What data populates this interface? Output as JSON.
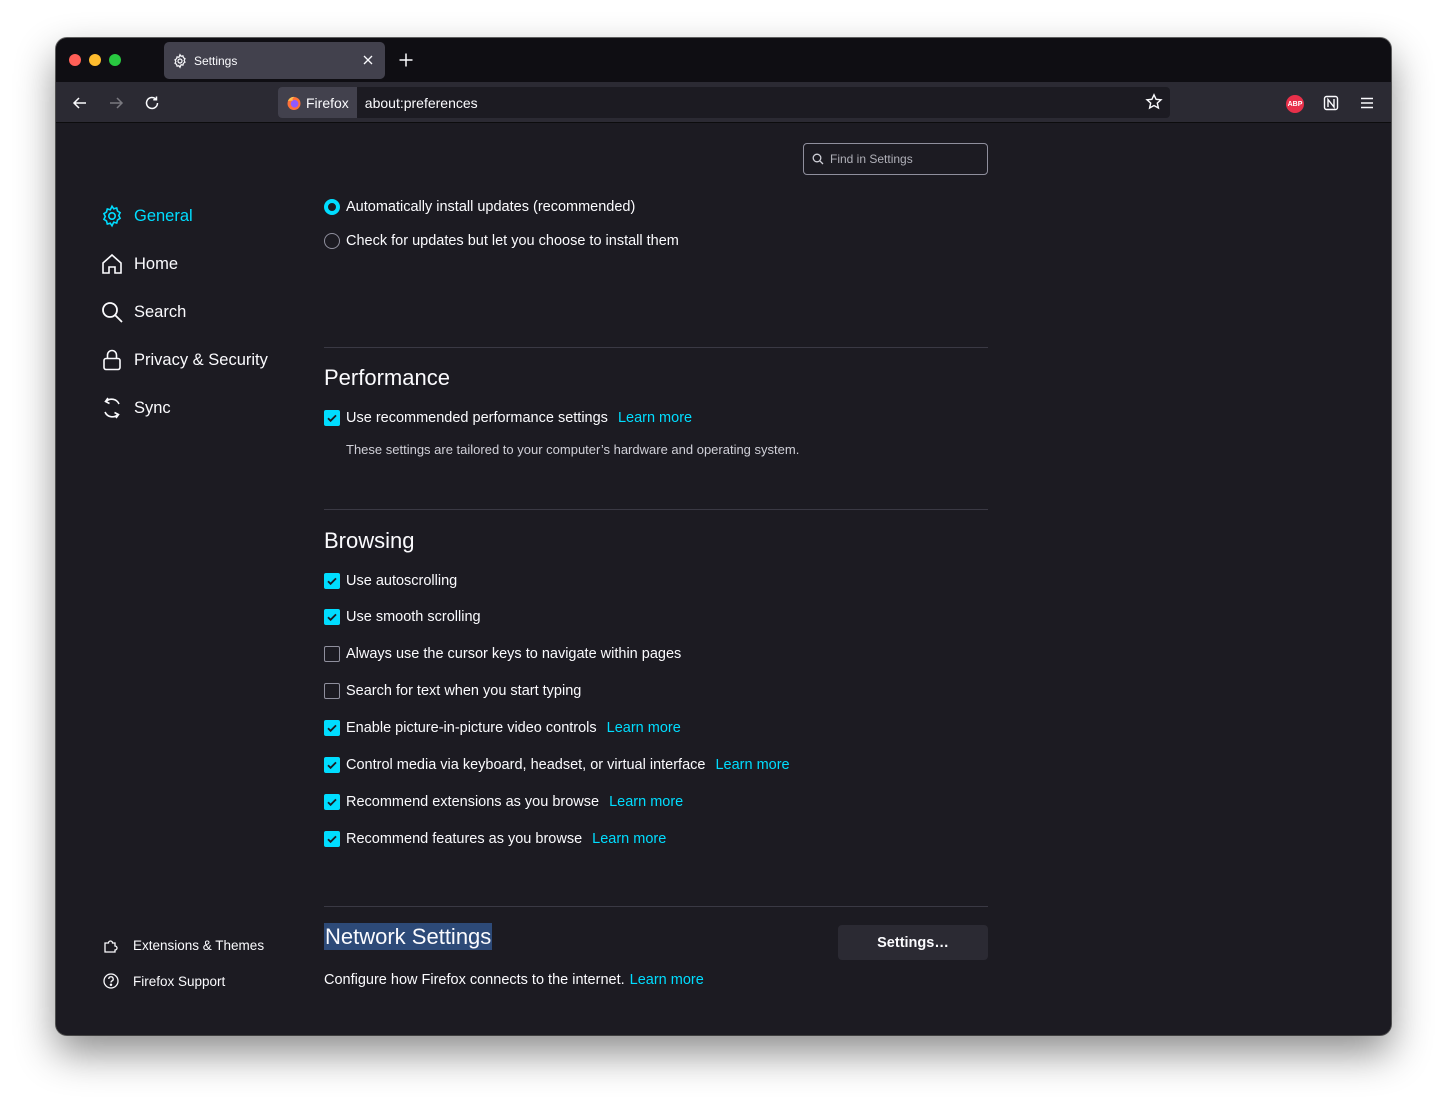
{
  "tab": {
    "title": "Settings",
    "icon": "gear-icon"
  },
  "urlbar": {
    "identity_label": "Firefox",
    "url": "about:preferences"
  },
  "extensions": {
    "abp_label": "ABP"
  },
  "search": {
    "placeholder": "Find in Settings"
  },
  "sidebar": {
    "items": [
      {
        "label": "General",
        "icon": "gear-icon",
        "active": true
      },
      {
        "label": "Home",
        "icon": "home-icon"
      },
      {
        "label": "Search",
        "icon": "search-icon"
      },
      {
        "label": "Privacy & Security",
        "icon": "lock-icon"
      },
      {
        "label": "Sync",
        "icon": "sync-icon"
      }
    ],
    "footer": [
      {
        "label": "Extensions & Themes",
        "icon": "puzzle-icon"
      },
      {
        "label": "Firefox Support",
        "icon": "help-icon"
      }
    ]
  },
  "updates": {
    "auto_install": "Automatically install updates (recommended)",
    "check_only": "Check for updates but let you choose to install them"
  },
  "performance": {
    "heading": "Performance",
    "recommended": "Use recommended performance settings",
    "learn_more": "Learn more",
    "description": "These settings are tailored to your computer’s hardware and operating system."
  },
  "browsing": {
    "heading": "Browsing",
    "options": [
      {
        "label": "Use autoscrolling",
        "checked": true
      },
      {
        "label": "Use smooth scrolling",
        "checked": true
      },
      {
        "label": "Always use the cursor keys to navigate within pages",
        "checked": false
      },
      {
        "label": "Search for text when you start typing",
        "checked": false
      },
      {
        "label": "Enable picture-in-picture video controls",
        "checked": true,
        "link": "Learn more"
      },
      {
        "label": "Control media via keyboard, headset, or virtual interface",
        "checked": true,
        "link": "Learn more"
      },
      {
        "label": "Recommend extensions as you browse",
        "checked": true,
        "link": "Learn more"
      },
      {
        "label": "Recommend features as you browse",
        "checked": true,
        "link": "Learn more"
      }
    ]
  },
  "network": {
    "heading": "Network Settings",
    "description": "Configure how Firefox connects to the internet.",
    "learn_more": "Learn more",
    "button": "Settings…"
  },
  "colors": {
    "accent": "#00ddff",
    "background": "#1c1b22",
    "toolbar": "#2b2a33"
  }
}
